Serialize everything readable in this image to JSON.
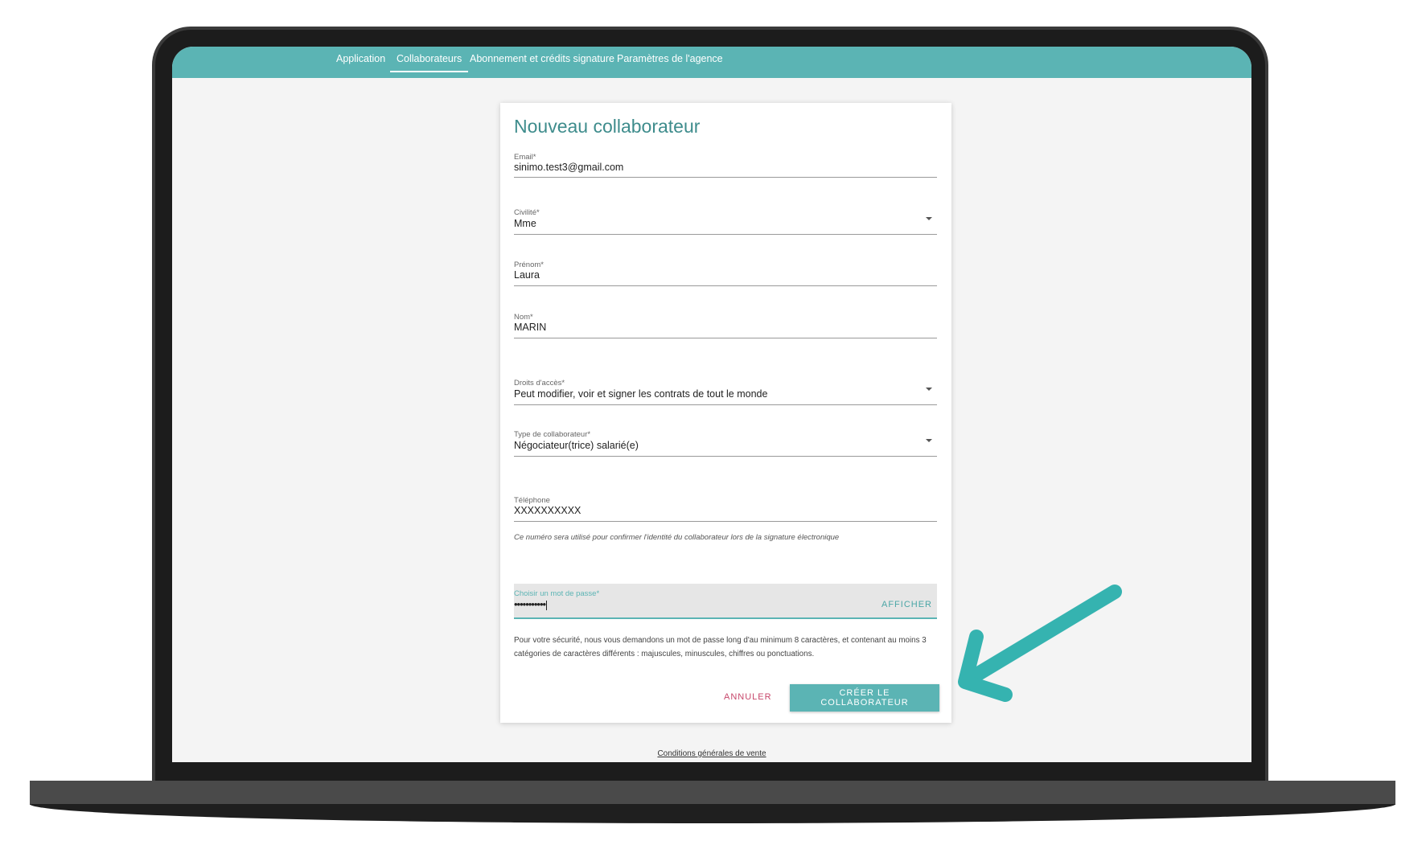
{
  "nav": {
    "tabs": [
      {
        "label": "Application"
      },
      {
        "label": "Collaborateurs"
      },
      {
        "label": "Abonnement et crédits signature"
      },
      {
        "label": "Paramètres de l'agence"
      }
    ],
    "active": "Collaborateurs"
  },
  "form": {
    "title": "Nouveau collaborateur",
    "email": {
      "label": "Email*",
      "value": "sinimo.test3@gmail.com"
    },
    "civilite": {
      "label": "Civilité*",
      "value": "Mme"
    },
    "prenom": {
      "label": "Prénom*",
      "value": "Laura"
    },
    "nom": {
      "label": "Nom*",
      "value": "MARIN"
    },
    "droits": {
      "label": "Droits d'accès*",
      "value": "Peut modifier, voir et signer les contrats de tout le monde"
    },
    "type": {
      "label": "Type de collaborateur*",
      "value": "Négociateur(trice) salarié(e)"
    },
    "telephone": {
      "label": "Téléphone",
      "value": "XXXXXXXXXX",
      "hint": "Ce numéro sera utilisé pour confirmer l'identité du collaborateur lors de la signature électronique"
    },
    "password": {
      "label": "Choisir un mot de passe*",
      "value": "•••••••••••",
      "show_label": "AFFICHER"
    },
    "security_note": "Pour votre sécurité, nous vous demandons un mot de passe long d'au minimum 8 caractères, et contenant au moins 3 catégories de caractères différents : majuscules, minuscules, chiffres ou ponctuations.",
    "cancel_label": "ANNULER",
    "create_label": "CRÉER LE COLLABORATEUR"
  },
  "footer": {
    "cgv_label": "Conditions générales de vente"
  },
  "colors": {
    "accent": "#5bb4b4",
    "title": "#3e8c8c",
    "cancel": "#c7476b",
    "arrow": "#35b3b0"
  },
  "icons": {
    "dropdown": "chevron-down-icon",
    "annotation": "arrow-icon"
  }
}
